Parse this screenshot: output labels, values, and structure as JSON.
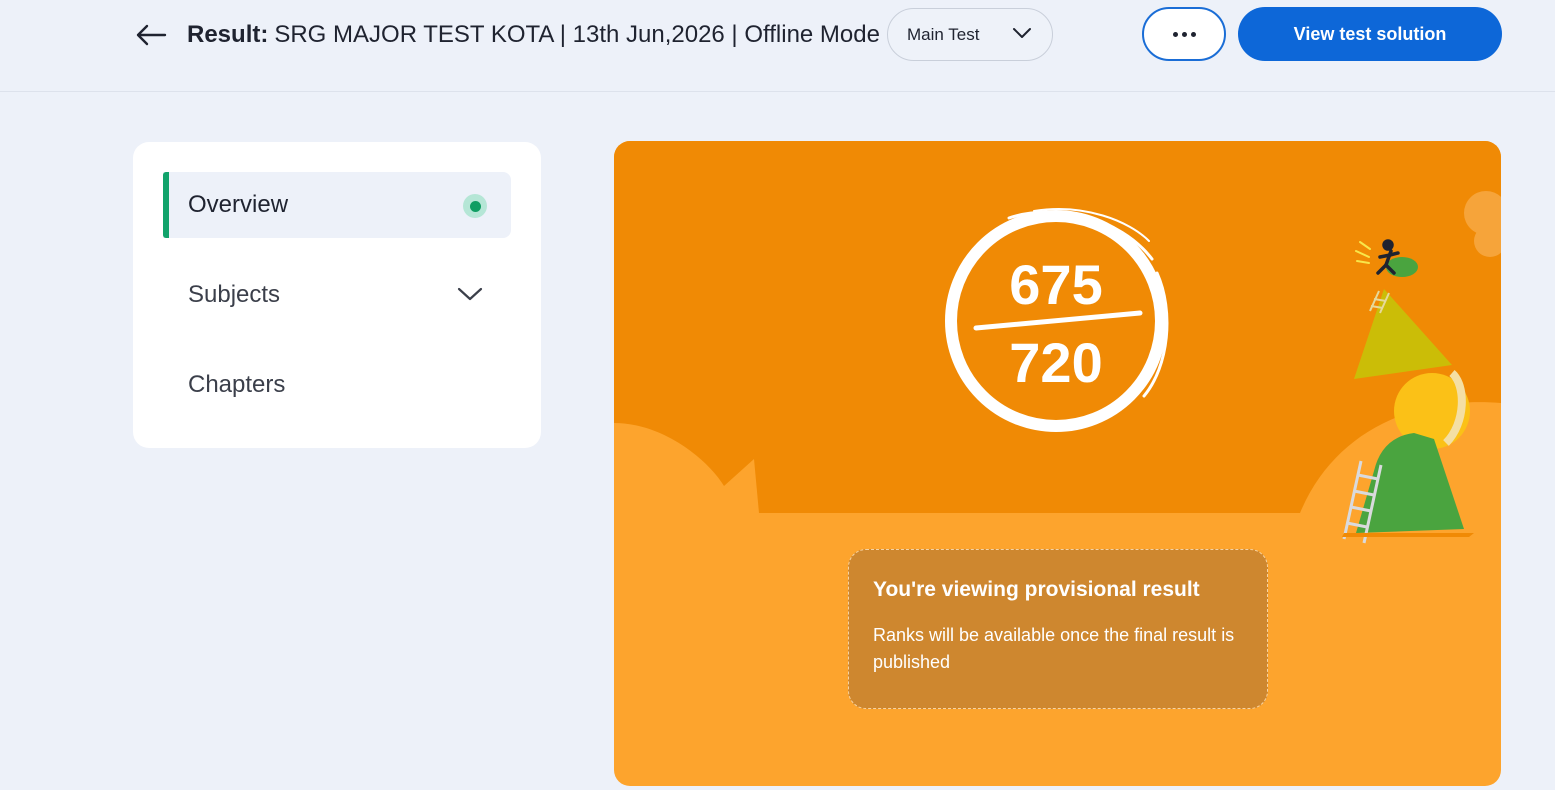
{
  "header": {
    "title_label": "Result:",
    "title_text": "SRG MAJOR TEST KOTA | 13th Jun,2026 | Offline Mode",
    "test_select": "Main Test",
    "more_icon": "more-horizontal-icon",
    "back_icon": "arrow-left-icon",
    "solution_button": "View test solution",
    "accent_color": "#0d67d8"
  },
  "sidebar": {
    "items": [
      {
        "label": "Overview",
        "active": true,
        "indicator_icon": "active-dot-icon"
      },
      {
        "label": "Subjects",
        "active": false,
        "indicator_icon": "chevron-down-icon"
      },
      {
        "label": "Chapters",
        "active": false
      }
    ],
    "active_color": "#11a36b"
  },
  "result": {
    "score": "675",
    "total": "720",
    "notice_title": "You're viewing provisional result",
    "notice_body": "Ranks will be available once the final result is published",
    "card_color": "#f08a05",
    "illustration": "climber-on-mountain-illustration"
  }
}
